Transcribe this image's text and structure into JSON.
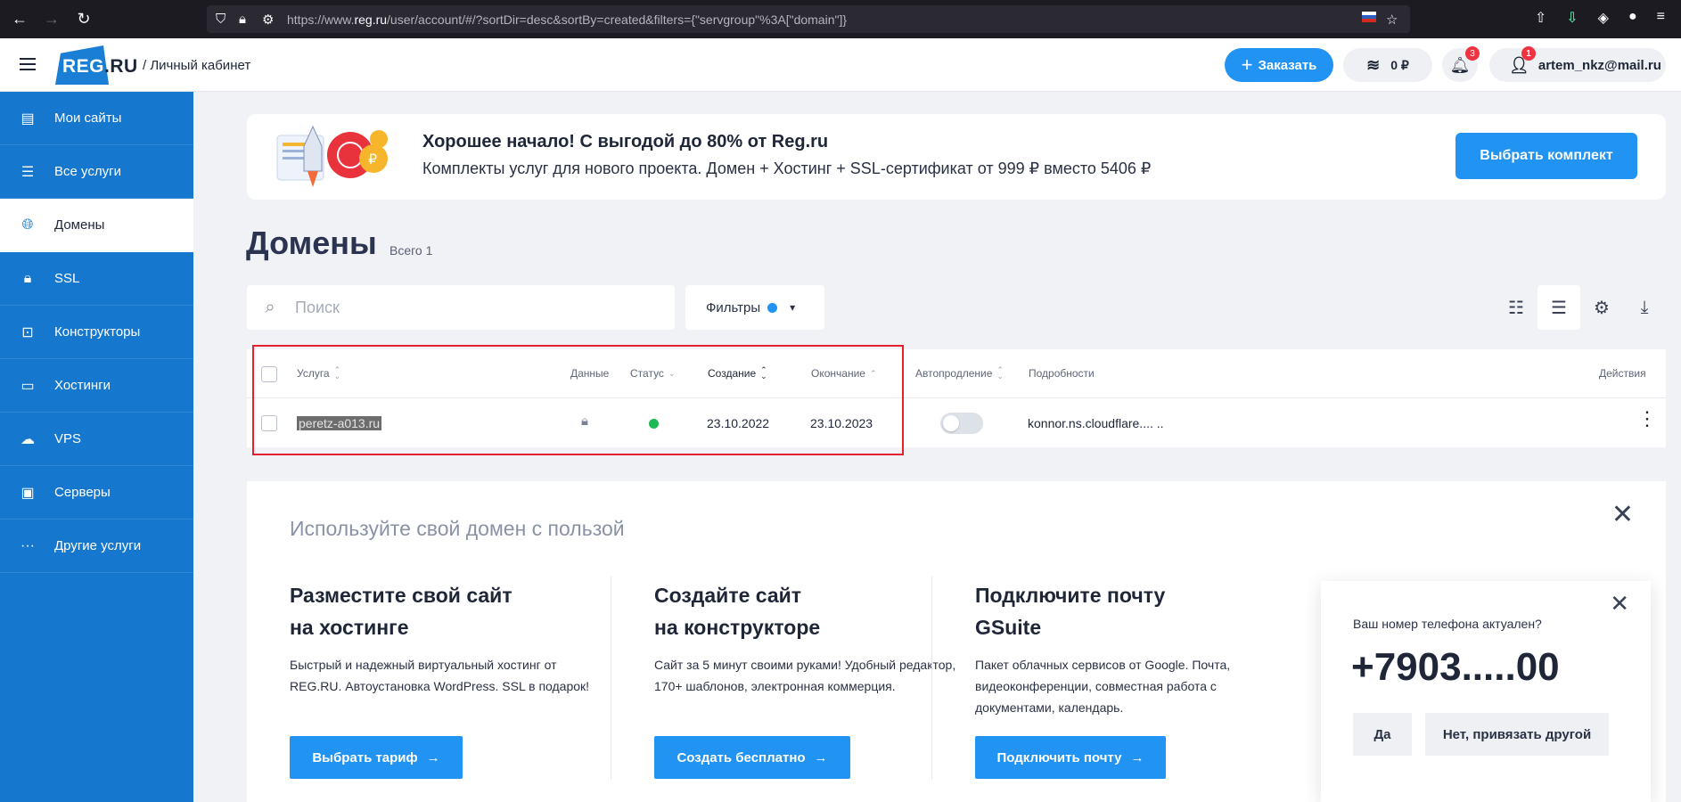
{
  "browser": {
    "url_prefix": "https://www.",
    "url_domain": "reg.ru",
    "url_rest": "/user/account/#/?sortDir=desc&sortBy=created&filters={\"servgroup\"%3A[\"domain\"]}"
  },
  "header": {
    "logo_brand": "REG",
    "logo_suffix": ".RU",
    "logo_subtitle": "/ Личный кабинет",
    "order_label": "Заказать",
    "balance": "0 ₽",
    "notifications_count": "3",
    "account_badge": "1",
    "account_email": "artem_nkz@mail.ru"
  },
  "sidebar": {
    "items": [
      {
        "label": "Мои сайты",
        "icon": "sites-icon"
      },
      {
        "label": "Все услуги",
        "icon": "list-icon"
      },
      {
        "label": "Домены",
        "icon": "globe-icon"
      },
      {
        "label": "SSL",
        "icon": "ssl-lock-icon"
      },
      {
        "label": "Конструкторы",
        "icon": "constructor-icon"
      },
      {
        "label": "Хостинги",
        "icon": "hosting-icon"
      },
      {
        "label": "VPS",
        "icon": "vps-icon"
      },
      {
        "label": "Серверы",
        "icon": "server-icon"
      },
      {
        "label": "Другие услуги",
        "icon": "more-dots-icon"
      }
    ],
    "active_index": 2
  },
  "promo": {
    "title": "Хорошее начало! С выгодой до 80% от Reg.ru",
    "subtitle": "Комплекты услуг для нового проекта. Домен + Хостинг + SSL-сертификат от 999 ₽ вместо 5406 ₽",
    "button": "Выбрать комплект"
  },
  "page": {
    "title": "Домены",
    "count": "Всего 1"
  },
  "toolbar": {
    "search_placeholder": "Поиск",
    "filters_label": "Фильтры"
  },
  "table": {
    "headers": {
      "service": "Услуга",
      "data": "Данные",
      "status": "Статус",
      "created": "Создание",
      "expires": "Окончание",
      "autorenew": "Автопродление",
      "details": "Подробности",
      "actions": "Действия"
    },
    "rows": [
      {
        "domain": "peretz-a013.ru",
        "created": "23.10.2022",
        "expires": "23.10.2023",
        "details": "konnor.ns.cloudflare....  ..",
        "status_color": "#1db954"
      }
    ]
  },
  "suggest": {
    "title": "Используйте свой домен с пользой",
    "columns": [
      {
        "title_line1": "Разместите свой сайт",
        "title_line2": "на хостинге",
        "text": "Быстрый и надежный виртуальный хостинг от REG.RU. Автоустановка WordPress. SSL в подарок!",
        "button": "Выбрать тариф"
      },
      {
        "title_line1": "Создайте сайт",
        "title_line2": "на конструкторе",
        "text": "Сайт за 5 минут своими руками! Удобный редактор, 170+ шаблонов, электронная коммерция.",
        "button": "Создать бесплатно"
      },
      {
        "title_line1": "Подключите почту",
        "title_line2": "GSuite",
        "text": "Пакет облачных сервисов от Google. Почта, видеоконференции, совместная работа с документами, календарь.",
        "button": "Подключить почту"
      }
    ]
  },
  "phone_popup": {
    "question": "Ваш номер телефона актуален?",
    "number": "+7903.....00",
    "yes": "Да",
    "no": "Нет, привязать другой"
  },
  "colors": {
    "accent": "#2193f3",
    "sidebar": "#1677cf",
    "highlight": "#e3202b"
  }
}
